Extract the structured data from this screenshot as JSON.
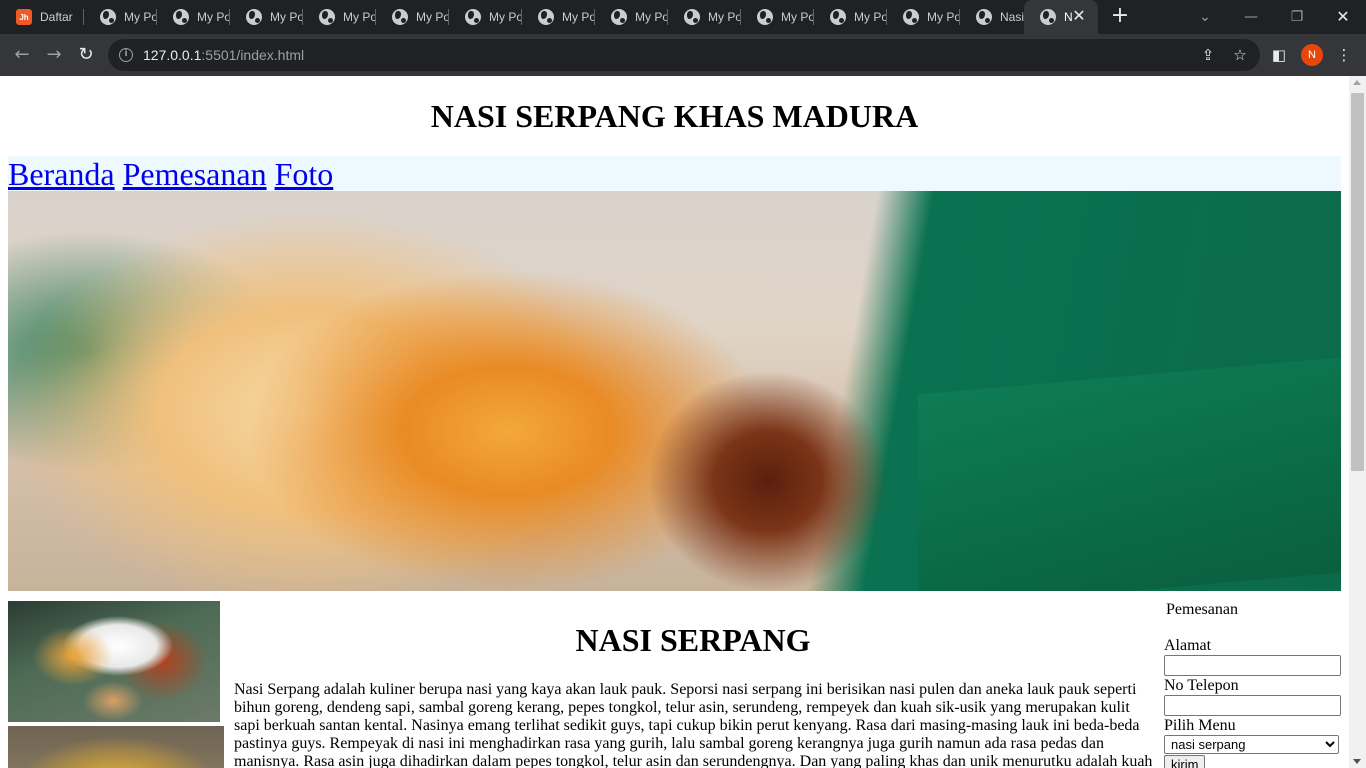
{
  "browser": {
    "tabs": [
      {
        "title": "Daftar",
        "favicon": "brand-icon"
      },
      {
        "title": "My Po",
        "favicon": "globe-icon"
      },
      {
        "title": "My Po",
        "favicon": "globe-icon"
      },
      {
        "title": "My Po",
        "favicon": "globe-icon"
      },
      {
        "title": "My Po",
        "favicon": "globe-icon"
      },
      {
        "title": "My Po",
        "favicon": "globe-icon"
      },
      {
        "title": "My Po",
        "favicon": "globe-icon"
      },
      {
        "title": "My Po",
        "favicon": "globe-icon"
      },
      {
        "title": "My Po",
        "favicon": "globe-icon"
      },
      {
        "title": "My Po",
        "favicon": "globe-icon"
      },
      {
        "title": "My Po",
        "favicon": "globe-icon"
      },
      {
        "title": "My Po",
        "favicon": "globe-icon"
      },
      {
        "title": "My Po",
        "favicon": "globe-icon"
      },
      {
        "title": "Nasi S",
        "favicon": "globe-icon"
      },
      {
        "title": "N",
        "favicon": "globe-icon",
        "active": true
      }
    ],
    "brand_favicon_text": "Jh",
    "address": {
      "host": "127.0.0.1",
      "rest": ":5501/index.html"
    },
    "profile_initial": "N"
  },
  "page": {
    "title": "NASI SERPANG KHAS MADURA",
    "nav": [
      "Beranda",
      "Pemesanan",
      "Foto"
    ],
    "article": {
      "heading": "NASI SERPANG",
      "body": "Nasi Serpang adalah kuliner berupa nasi yang kaya akan lauk pauk. Seporsi nasi serpang ini berisikan nasi pulen dan aneka lauk pauk seperti bihun goreng, dendeng sapi, sambal goreng kerang, pepes tongkol, telur asin, serundeng, rempeyek dan kuah sik-usik yang merupakan kulit sapi berkuah santan kental. Nasinya emang terlihat sedikit guys, tapi cukup bikin perut kenyang. Rasa dari masing-masing lauk ini beda-beda pastinya guys. Rempeyak di nasi ini menghadirkan rasa yang gurih, lalu sambal goreng kerangnya juga gurih namun ada rasa pedas dan manisnya. Rasa asin juga dihadirkan dalam pepes tongkol, telur asin dan serundengnya. Dan yang paling khas dan unik menurutku adalah kuah"
    },
    "form": {
      "legend": "Pemesanan",
      "alamat_label": "Alamat",
      "alamat_value": "",
      "telepon_label": "No Telepon",
      "telepon_value": "",
      "menu_label": "Pilih Menu",
      "menu_selected": "nasi serpang",
      "submit_label": "kirim"
    }
  }
}
